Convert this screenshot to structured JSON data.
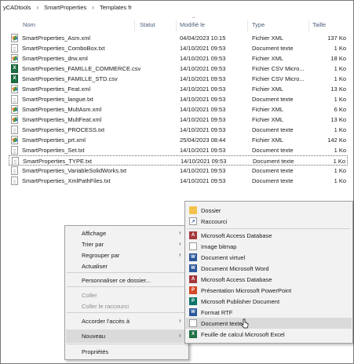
{
  "breadcrumb": [
    "yCADtools",
    "SmartProperties",
    "Templates fr"
  ],
  "columns": {
    "name": "Nom",
    "status": "Statut",
    "modified": "Modifié le",
    "type": "Type",
    "size": "Taille"
  },
  "files": [
    {
      "name": "SmartProperties_Asm.xml",
      "modified": "04/04/2023 10:15",
      "type": "Fichier XML",
      "size": "137 Ko",
      "icon": "xml-file-icon"
    },
    {
      "name": "SmartProperties_ComboBox.txt",
      "modified": "14/10/2021 09:53",
      "type": "Document texte",
      "size": "1 Ko",
      "icon": "text-file-icon"
    },
    {
      "name": "SmartProperties_drw.xml",
      "modified": "14/10/2021 09:53",
      "type": "Fichier XML",
      "size": "18 Ko",
      "icon": "xml-file-icon"
    },
    {
      "name": "SmartProperties_FAMILLE_COMMERCE.csv",
      "modified": "14/10/2021 09:53",
      "type": "Fichier CSV Micro...",
      "size": "1 Ko",
      "icon": "csv-file-icon"
    },
    {
      "name": "SmartProperties_FAMILLE_STD.csv",
      "modified": "14/10/2021 09:53",
      "type": "Fichier CSV Micro...",
      "size": "1 Ko",
      "icon": "csv-file-icon"
    },
    {
      "name": "SmartProperties_Feat.xml",
      "modified": "14/10/2021 09:53",
      "type": "Fichier XML",
      "size": "13 Ko",
      "icon": "xml-file-icon"
    },
    {
      "name": "SmartProperties_langue.txt",
      "modified": "14/10/2021 09:53",
      "type": "Document texte",
      "size": "1 Ko",
      "icon": "text-file-icon"
    },
    {
      "name": "SmartProperties_MultAsm.xml",
      "modified": "14/10/2021 09:53",
      "type": "Fichier XML",
      "size": "6 Ko",
      "icon": "xml-file-icon"
    },
    {
      "name": "SmartProperties_MultFeat.xml",
      "modified": "14/10/2021 09:53",
      "type": "Fichier XML",
      "size": "13 Ko",
      "icon": "xml-file-icon"
    },
    {
      "name": "SmartProperties_PROCESS.txt",
      "modified": "14/10/2021 09:53",
      "type": "Document texte",
      "size": "1 Ko",
      "icon": "text-file-icon"
    },
    {
      "name": "SmartProperties_prt.xml",
      "modified": "25/04/2023 08:44",
      "type": "Fichier XML",
      "size": "142 Ko",
      "icon": "xml-file-icon"
    },
    {
      "name": "SmartProperties_Set.txt",
      "modified": "14/10/2021 09:53",
      "type": "Document texte",
      "size": "1 Ko",
      "icon": "text-file-icon"
    },
    {
      "name": "SmartProperties_TYPE.txt",
      "modified": "14/10/2021 09:53",
      "type": "Document texte",
      "size": "1 Ko",
      "icon": "text-file-icon"
    },
    {
      "name": "SmartProperties_VariableSolidWorks.txt",
      "modified": "14/10/2021 09:53",
      "type": "Document texte",
      "size": "1 Ko",
      "icon": "text-file-icon"
    },
    {
      "name": "SmartProperties_XmlPathFiles.txt",
      "modified": "14/10/2021 09:53",
      "type": "Document texte",
      "size": "1 Ko",
      "icon": "text-file-icon"
    }
  ],
  "selected_file": "SmartProperties_TYPE.txt",
  "context_menu": {
    "view": "Affichage",
    "sort_by": "Trier par",
    "group_by": "Regrouper par",
    "refresh": "Actualiser",
    "customize": "Personnaliser ce dossier...",
    "paste": "Coller",
    "paste_shortcut": "Coller le raccourci",
    "give_access": "Accorder l'accès à",
    "new": "Nouveau",
    "properties": "Propriétés"
  },
  "new_submenu": {
    "folder": "Dossier",
    "shortcut": "Raccourci",
    "access_db_1": "Microsoft Access Database",
    "bitmap": "Image bitmap",
    "virtual_doc": "Document virtuel",
    "word_doc": "Document Microsoft Word",
    "access_db_2": "Microsoft Access Database",
    "powerpoint": "Présentation Microsoft PowerPoint",
    "publisher": "Microsoft Publisher Document",
    "rtf": "Format RTF",
    "text_doc": "Document texte",
    "excel": "Feuille de calcul Microsoft Excel"
  },
  "colors": {
    "word": "#2b579a",
    "access": "#a4373a",
    "powerpoint": "#d24726",
    "publisher": "#077568",
    "excel": "#1e7145",
    "folder": "#f3c24b"
  }
}
